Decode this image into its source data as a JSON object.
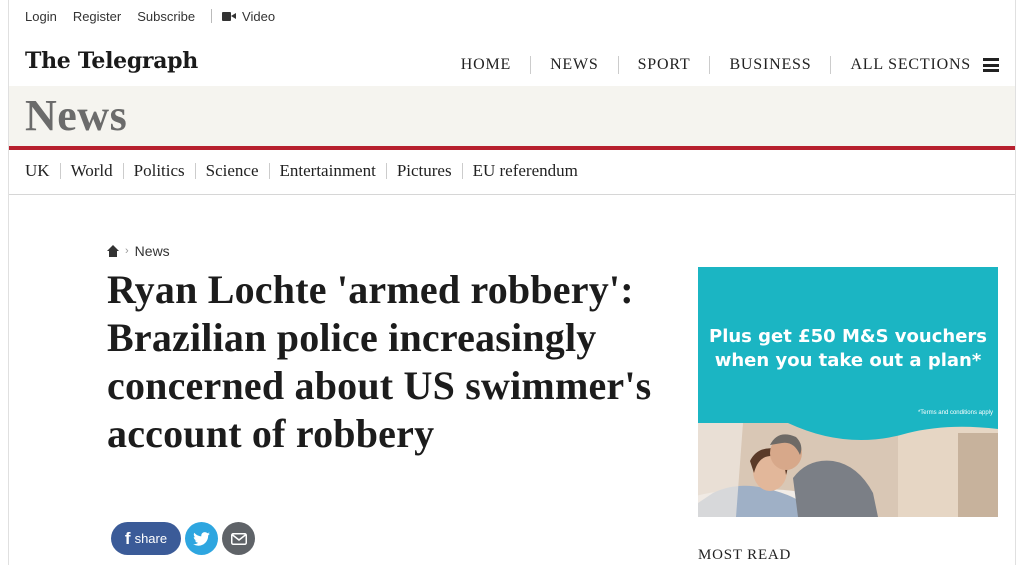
{
  "utility": {
    "login": "Login",
    "register": "Register",
    "subscribe": "Subscribe",
    "video": "Video",
    "video_icon": "video-camera-icon"
  },
  "masthead": {
    "logo": "The Telegraph",
    "nav": [
      "HOME",
      "NEWS",
      "SPORT",
      "BUSINESS",
      "ALL SECTIONS"
    ],
    "menu_icon": "hamburger-menu-icon"
  },
  "section": {
    "title": "News",
    "accent_color": "#b7202e"
  },
  "subnav": [
    "UK",
    "World",
    "Politics",
    "Science",
    "Entertainment",
    "Pictures",
    "EU referendum"
  ],
  "breadcrumb": {
    "home_icon": "home-icon",
    "current": "News"
  },
  "article": {
    "headline": "Ryan Lochte 'armed robbery': Brazilian police increasingly concerned about US swimmer's account of robbery"
  },
  "share": {
    "facebook_label": "share",
    "facebook_color": "#3b5b98",
    "twitter_color": "#2ea6e0",
    "email_color": "#5f6368"
  },
  "ad": {
    "line1": "Plus get £50 M&S vouchers",
    "line2": "when you take out a plan*",
    "terms": "*Terms and conditions apply",
    "background": "#1bb5c3"
  },
  "sidebar": {
    "most_read": "MOST READ"
  }
}
